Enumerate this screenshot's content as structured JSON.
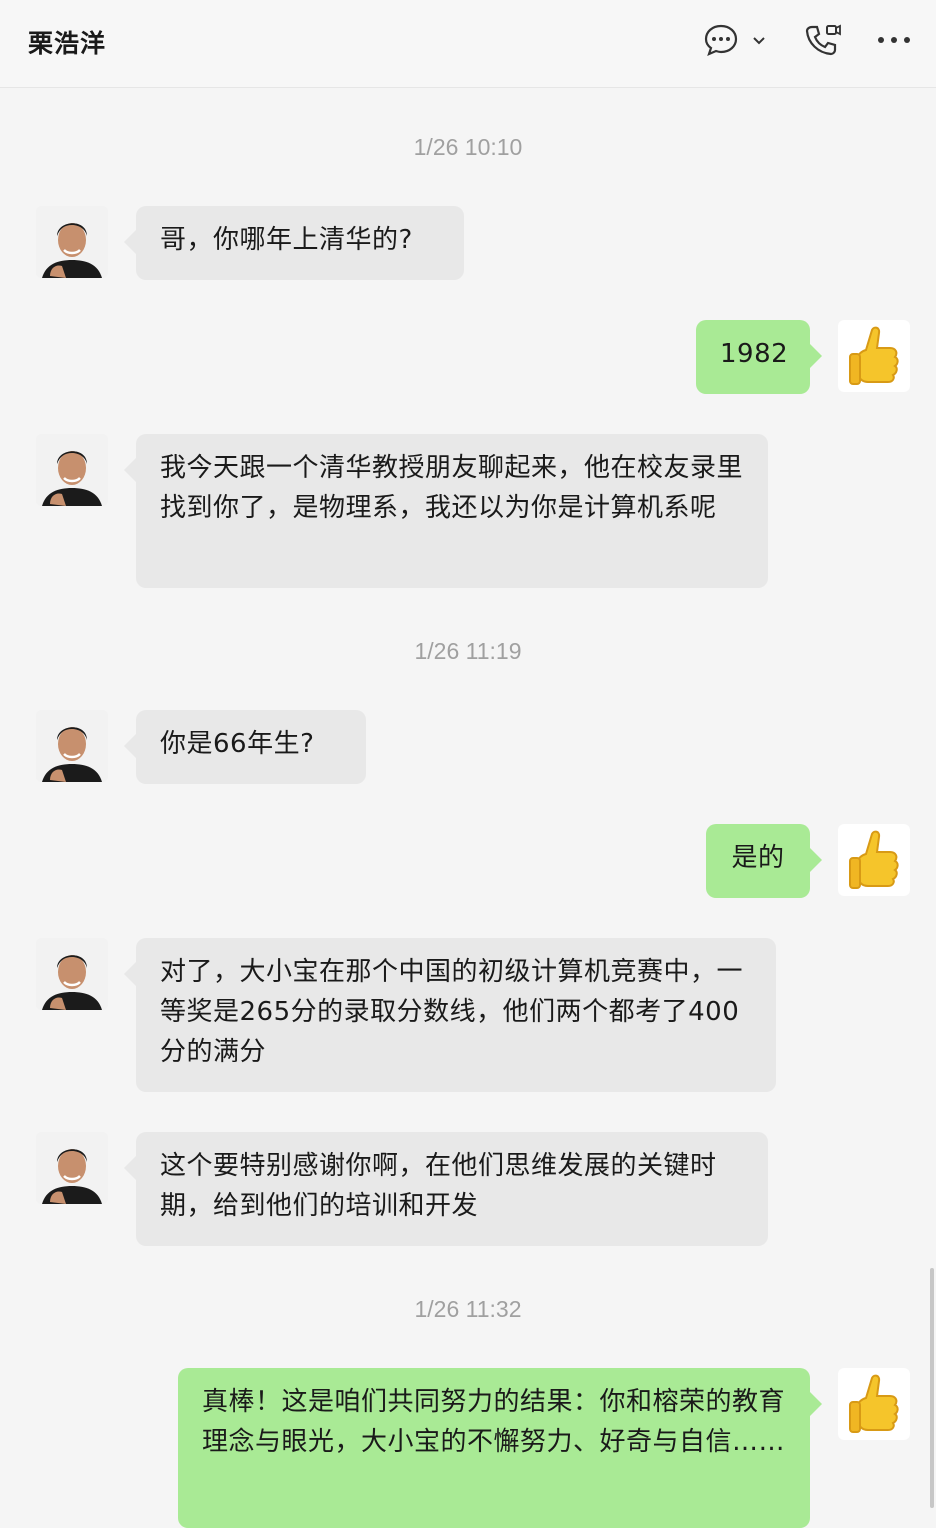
{
  "header": {
    "title": "栗浩洋",
    "icons": [
      "chat-bubble-icon",
      "chevron-down-icon",
      "video-call-icon",
      "more-icon"
    ]
  },
  "messages": {
    "t1": "1/26 10:10",
    "m1": "哥，你哪年上清华的?",
    "m2": "1982",
    "m3": "我今天跟一个清华教授朋友聊起来，他在校友录里找到你了，是物理系，我还以为你是计算机系呢",
    "t2": "1/26 11:19",
    "m4": "你是66年生?",
    "m5": "是的",
    "m6": "对了，大小宝在那个中国的初级计算机竞赛中，一等奖是265分的录取分数线，他们两个都考了400分的满分",
    "m7": "这个要特别感谢你啊，在他们思维发展的关键时期，给到他们的培训和开发",
    "t3": "1/26 11:32",
    "m8": "真棒！这是咱们共同努力的结果：你和榕荣的教育理念与眼光，大小宝的不懈努力、好奇与自信……"
  },
  "colors": {
    "self_bubble": "#a9ea95",
    "other_bubble": "#e8e8e8",
    "timestamp": "#a0a0a0"
  }
}
